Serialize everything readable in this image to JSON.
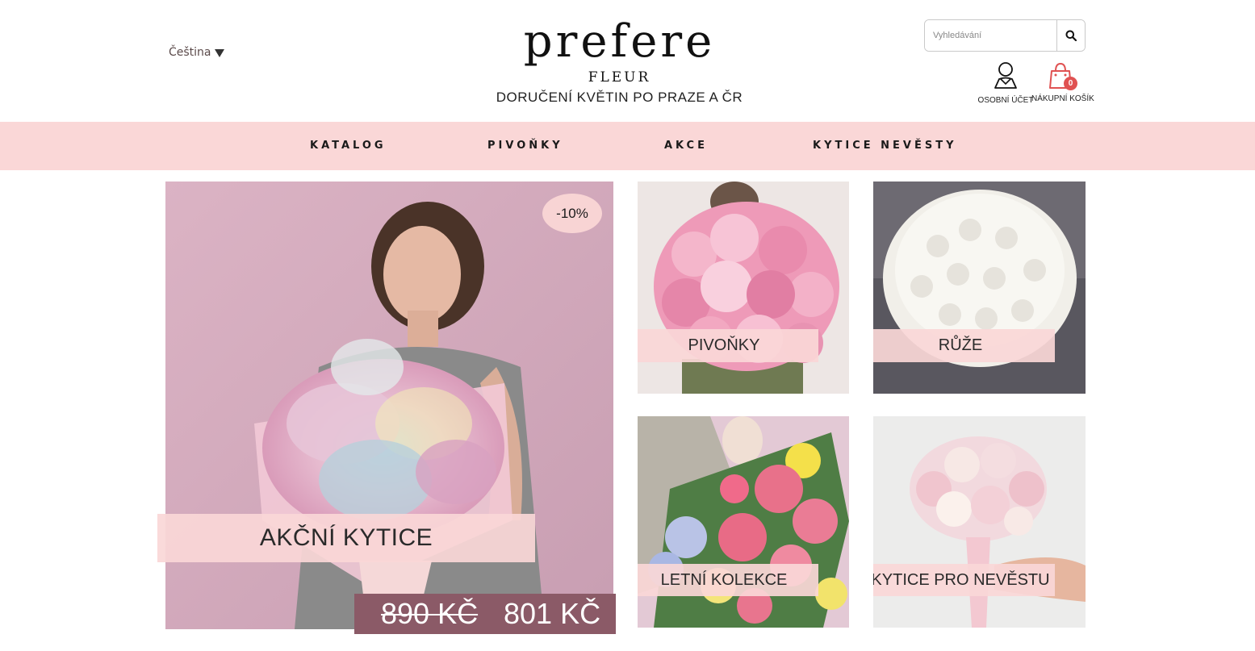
{
  "header": {
    "language": "Čeština",
    "brand": "prefere",
    "brand_sub": "FLEUR",
    "tagline": "DORUČENÍ KVĚTIN PO PRAZE A ČR",
    "search_placeholder": "Vyhledávání",
    "account_label": "OSOBNÍ ÚČET",
    "cart_label": "NÁKUPNÍ KOŠÍK",
    "cart_count": "0"
  },
  "nav": {
    "items": [
      {
        "label": "KATALOG"
      },
      {
        "label": "PIVOŇKY"
      },
      {
        "label": "AKCE"
      },
      {
        "label": "KYTICE NEVĚSTY"
      }
    ]
  },
  "hero": {
    "discount": "-10%",
    "label": "AKČNÍ KYTICE",
    "old_price": "890 KČ",
    "new_price": "801 KČ"
  },
  "categories": [
    {
      "label": "PIVOŇKY"
    },
    {
      "label": "RŮŽE"
    },
    {
      "label": "LETNÍ KOLEKCE"
    },
    {
      "label": "KYTICE PRO NEVĚSTU"
    }
  ],
  "colors": {
    "nav_bg": "#fad7d7",
    "label_bg": "#fad7d7",
    "price_bg": "#8b5a67",
    "badge": "#e05252"
  }
}
